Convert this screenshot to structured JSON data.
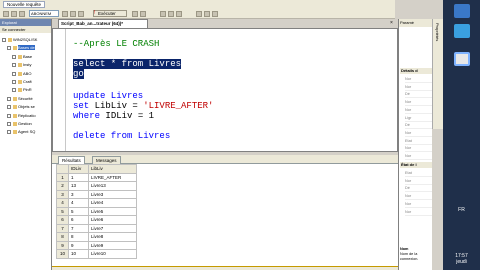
{
  "menubar": {
    "tab_label": "Nouvelle requête"
  },
  "toolbar": {
    "database": "ABONNEM",
    "execute_label": "Exécuter"
  },
  "explorer": {
    "title": "Explorat",
    "connect_label": "Se connecter",
    "items": [
      {
        "label": "WIN2SQL\\SK",
        "indent": 0,
        "selected": false
      },
      {
        "label": "Bases de",
        "indent": 1,
        "selected": true
      },
      {
        "label": "Base",
        "indent": 2,
        "selected": false
      },
      {
        "label": "Insty",
        "indent": 2,
        "selected": false
      },
      {
        "label": "ABO",
        "indent": 2,
        "selected": false
      },
      {
        "label": "Craft",
        "indent": 2,
        "selected": false
      },
      {
        "label": "PlnR",
        "indent": 2,
        "selected": false
      },
      {
        "label": "Sécurité",
        "indent": 1,
        "selected": false
      },
      {
        "label": "Objets se",
        "indent": 1,
        "selected": false
      },
      {
        "label": "Réplicatio",
        "indent": 1,
        "selected": false
      },
      {
        "label": "Gestion",
        "indent": 1,
        "selected": false
      },
      {
        "label": "Agent SQ",
        "indent": 1,
        "selected": false
      }
    ]
  },
  "editor": {
    "doc_tab": "Script_Bab_an...trateur (64))*",
    "close_glyph": "×",
    "lines": {
      "l1": "--Après LE CRASH",
      "l2": "select * from Livres",
      "l3": "go",
      "l4": "update Livres",
      "l5_kw": "set",
      "l5_mid": " LibLiv = ",
      "l5_str": "'LIVRE_AFTER'",
      "l6_kw": "where",
      "l6_rest": " IDLiv = 1",
      "l7": "delete from Livres"
    }
  },
  "results": {
    "tabs": [
      "Résultats",
      "Messages"
    ],
    "columns": [
      "IDLiv",
      "LibLiv"
    ],
    "rows": [
      {
        "rn": "1",
        "id": "1",
        "lib": "LIVRE_AFTER"
      },
      {
        "rn": "2",
        "id": "13",
        "lib": "Livre13"
      },
      {
        "rn": "3",
        "id": "3",
        "lib": "Livre3"
      },
      {
        "rn": "4",
        "id": "4",
        "lib": "Livre4"
      },
      {
        "rn": "5",
        "id": "5",
        "lib": "Livre5"
      },
      {
        "rn": "6",
        "id": "6",
        "lib": "Livre6"
      },
      {
        "rn": "7",
        "id": "7",
        "lib": "Livre7"
      },
      {
        "rn": "8",
        "id": "8",
        "lib": "Livre8"
      },
      {
        "rn": "9",
        "id": "9",
        "lib": "Livre9"
      },
      {
        "rn": "10",
        "id": "10",
        "lib": "Livre10"
      }
    ]
  },
  "properties": {
    "title": "Paramè",
    "section1": "Détails d",
    "rows1": [
      "Nor",
      "Nor",
      "Dé",
      "Nor",
      "Nor",
      "Ligr",
      "Dé",
      "Nor",
      "Etat",
      "Nor",
      "Nor"
    ],
    "section2": "État de l",
    "rows2": [
      "Etat",
      "Nor",
      "Dé",
      "Nor",
      "Nor",
      "Nor"
    ],
    "desc_title": "Nom",
    "desc_text": "Nom de la connexion.",
    "side_label": "Propriétés"
  },
  "system": {
    "language": "FR",
    "time": "17:57",
    "day": "jeudi",
    "icons": [
      "app-icon-1",
      "app-icon-2",
      "app-icon-3"
    ]
  },
  "colors": {
    "comment": "#008000",
    "keyword": "#0000ff",
    "string": "#c00000",
    "selection": "#0a246a",
    "sidebar": "#1f2f4a"
  }
}
